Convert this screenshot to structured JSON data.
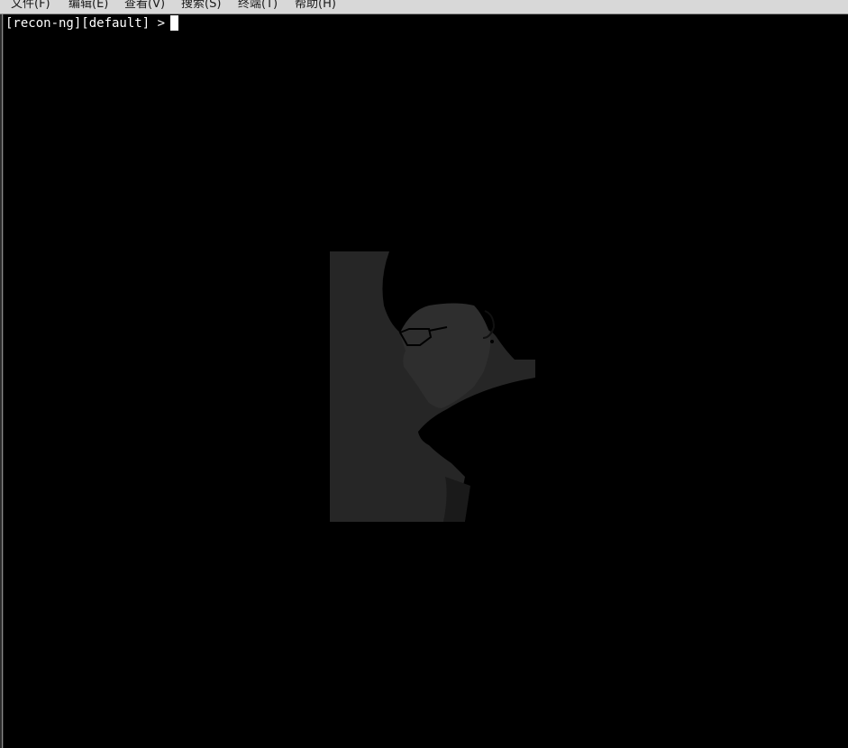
{
  "menubar": {
    "items": [
      {
        "label": "文件(F)"
      },
      {
        "label": "编辑(E)"
      },
      {
        "label": "查看(V)"
      },
      {
        "label": "搜索(S)"
      },
      {
        "label": "终端(T)"
      },
      {
        "label": "帮助(H)"
      }
    ]
  },
  "terminal": {
    "prompt": "[recon-ng][default] >",
    "background_color": "#000000",
    "text_color": "#ffffff"
  },
  "background_image": {
    "subject": "grayscale anime-style silhouette of person with glasses"
  }
}
